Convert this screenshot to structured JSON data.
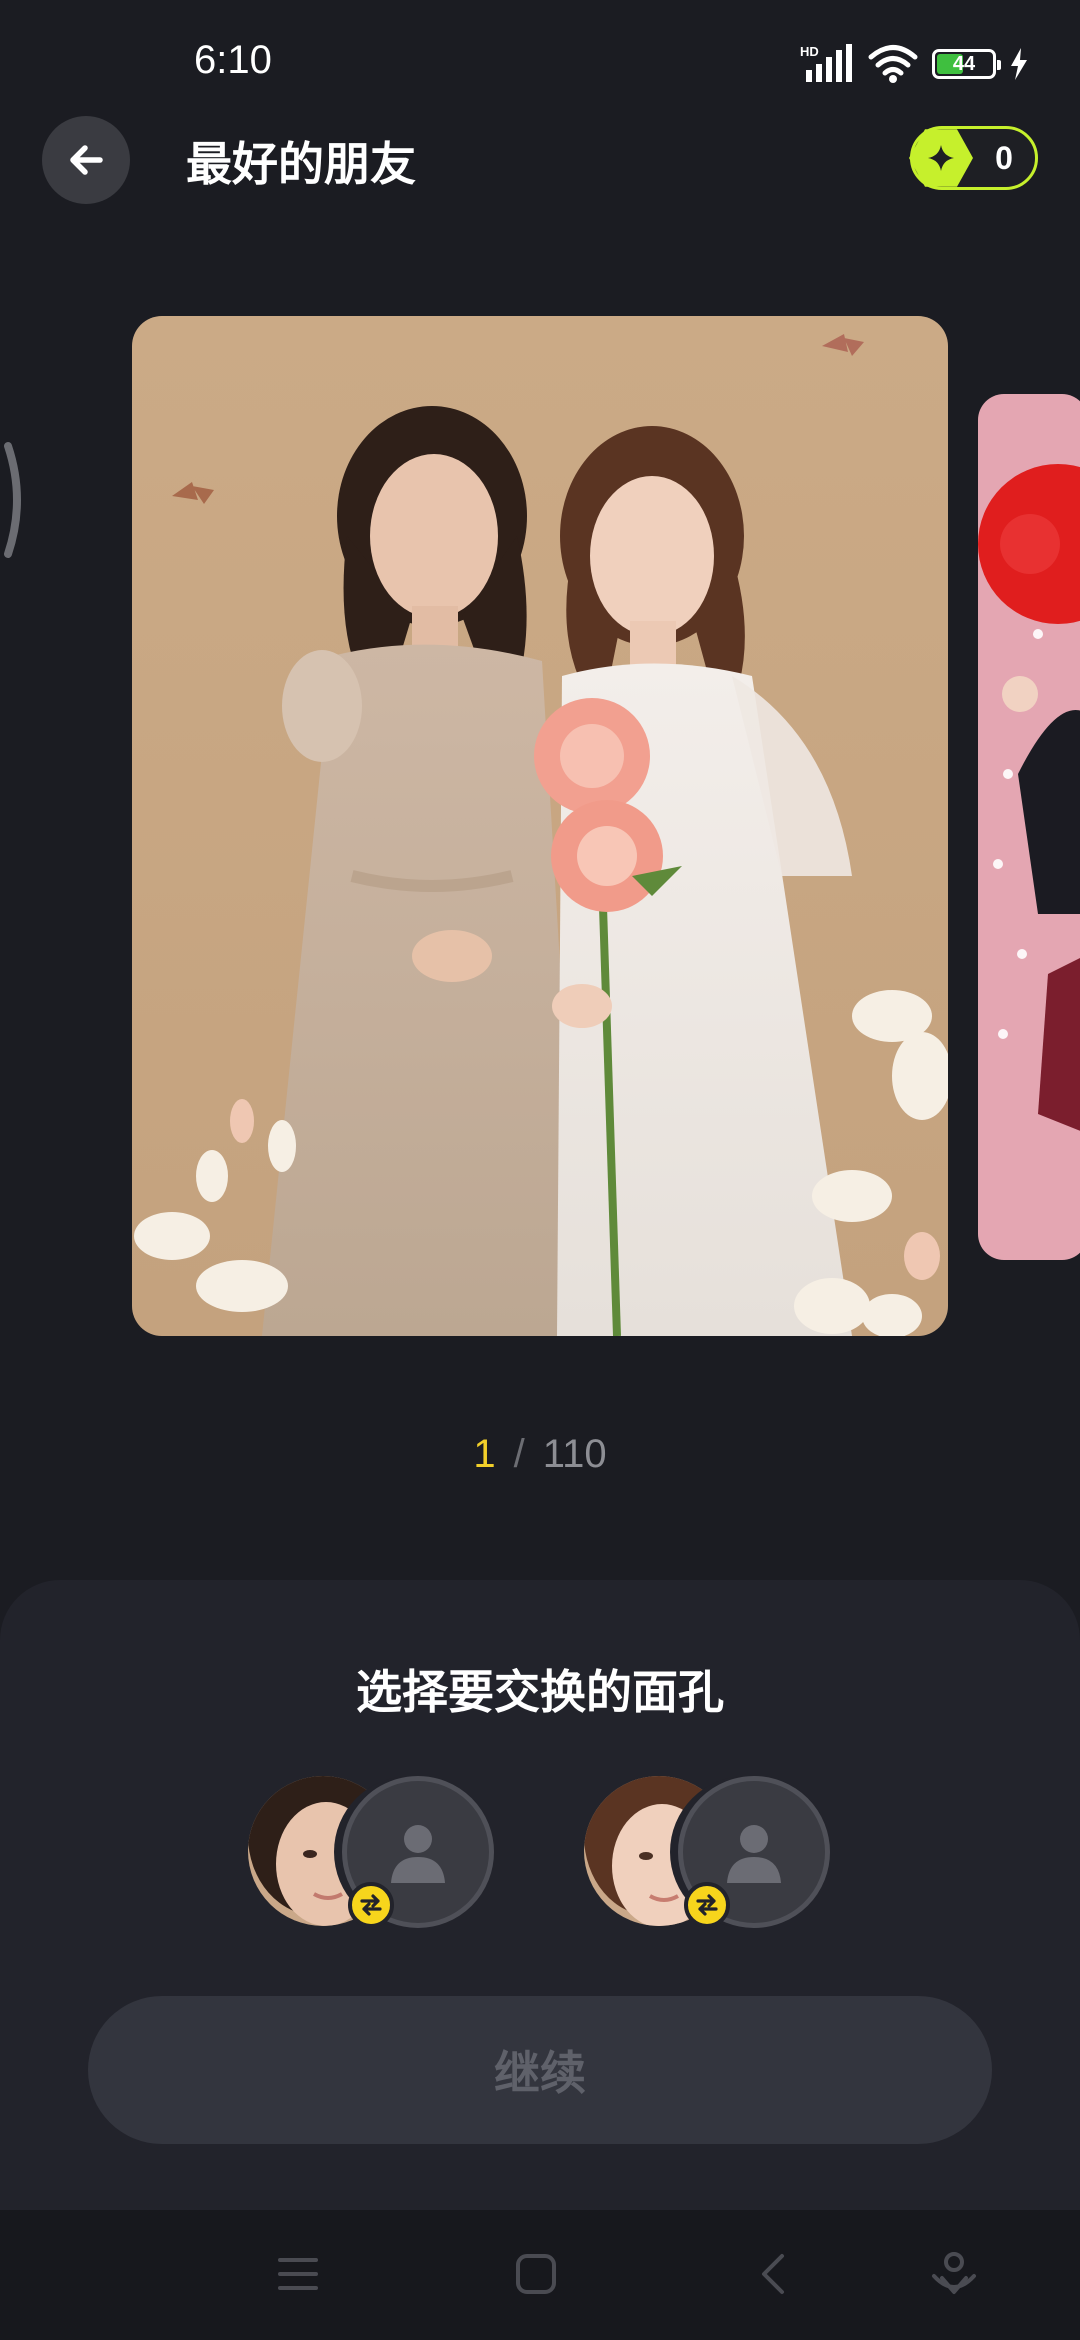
{
  "status_bar": {
    "time": "6:10",
    "network_label": "HD",
    "battery_level": "44",
    "battery_fraction": 0.44,
    "icons": [
      "signal-icon",
      "wifi-icon",
      "battery-icon",
      "charging-icon"
    ]
  },
  "header": {
    "title": "最好的朋友",
    "credits": "0",
    "back_icon": "arrow-left-icon",
    "credit_icon": "sparkle-icon"
  },
  "carousel": {
    "current": "1",
    "separator": "/",
    "total": "110"
  },
  "sheet": {
    "title": "选择要交换的面孔",
    "face_pairs": [
      {
        "source": "face-1",
        "target_icon": "person-placeholder-icon",
        "swap_icon": "swap-arrows-icon"
      },
      {
        "source": "face-2",
        "target_icon": "person-placeholder-icon",
        "swap_icon": "swap-arrows-icon"
      }
    ],
    "continue_label": "继续"
  },
  "nav_bar": {
    "items": [
      "menu-icon",
      "home-icon",
      "back-icon",
      "assistant-icon"
    ]
  },
  "colors": {
    "background": "#1b1c22",
    "accent_green": "#c6f02c",
    "accent_yellow": "#f2cf2a",
    "sheet": "#22232b",
    "button_disabled": "#33353e"
  }
}
